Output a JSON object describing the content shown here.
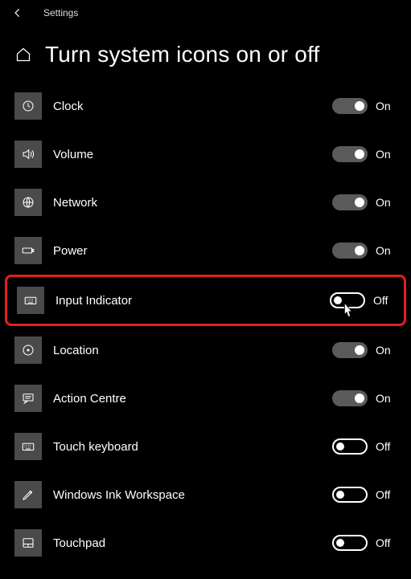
{
  "app": {
    "title": "Settings"
  },
  "page": {
    "title": "Turn system icons on or off"
  },
  "labels": {
    "on": "On",
    "off": "Off"
  },
  "items": [
    {
      "id": "clock",
      "label": "Clock",
      "state": "on",
      "highlighted": false,
      "icon": "clock"
    },
    {
      "id": "volume",
      "label": "Volume",
      "state": "on",
      "highlighted": false,
      "icon": "volume"
    },
    {
      "id": "network",
      "label": "Network",
      "state": "on",
      "highlighted": false,
      "icon": "globe"
    },
    {
      "id": "power",
      "label": "Power",
      "state": "on",
      "highlighted": false,
      "icon": "battery"
    },
    {
      "id": "input-indicator",
      "label": "Input Indicator",
      "state": "off",
      "highlighted": true,
      "icon": "keyboard"
    },
    {
      "id": "location",
      "label": "Location",
      "state": "on",
      "highlighted": false,
      "icon": "target"
    },
    {
      "id": "action-centre",
      "label": "Action Centre",
      "state": "on",
      "highlighted": false,
      "icon": "message"
    },
    {
      "id": "touch-keyboard",
      "label": "Touch keyboard",
      "state": "off",
      "highlighted": false,
      "icon": "keyboard"
    },
    {
      "id": "windows-ink",
      "label": "Windows Ink Workspace",
      "state": "off",
      "highlighted": false,
      "icon": "pen"
    },
    {
      "id": "touchpad",
      "label": "Touchpad",
      "state": "off",
      "highlighted": false,
      "icon": "touchpad"
    }
  ],
  "cursor": {
    "on_item": "input-indicator"
  }
}
